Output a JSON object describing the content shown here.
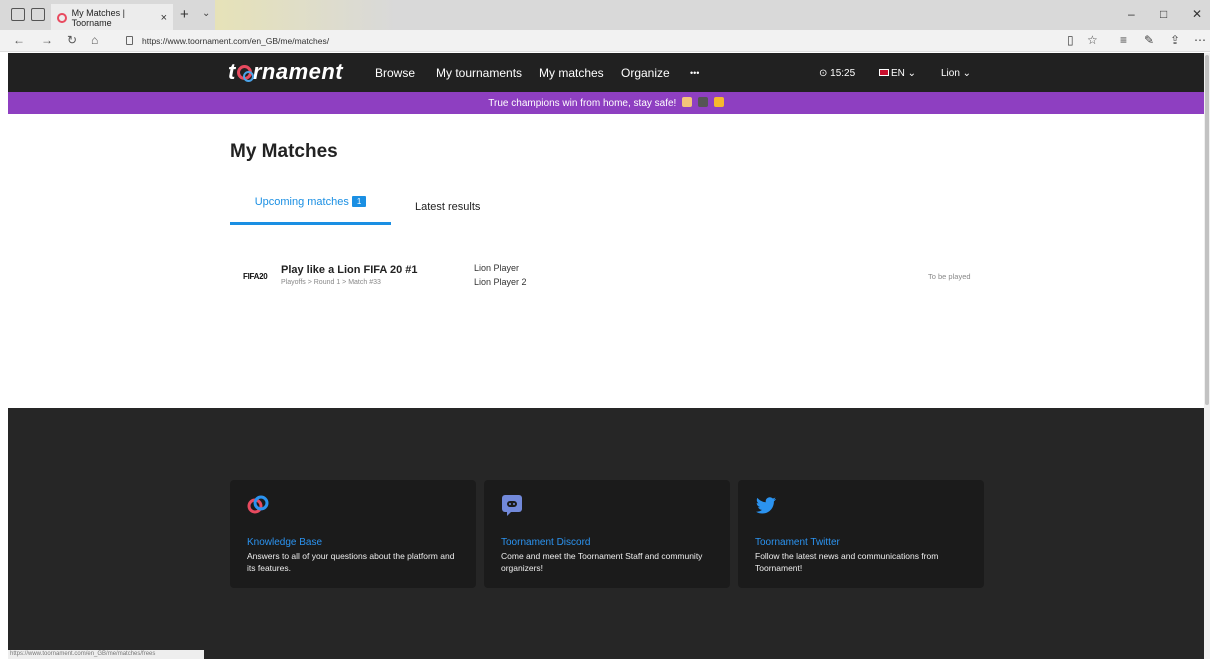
{
  "browser": {
    "tab_title": "My Matches | Toorname",
    "url": "https://www.toornament.com/en_GB/me/matches/",
    "new_tab": "+",
    "tab_close": "×",
    "window_controls": [
      "–",
      "□",
      "✕"
    ]
  },
  "header": {
    "logo": "toornament",
    "nav": [
      "Browse",
      "My tournaments",
      "My matches",
      "Organize",
      "•••"
    ],
    "clock": "⊙ 15:25",
    "language": "EN ⌄",
    "user": "Lion ⌄"
  },
  "banner": {
    "text": "True champions win from home, stay safe!"
  },
  "main": {
    "title": "My Matches",
    "tabs": {
      "upcoming": {
        "label": "Upcoming matches",
        "count": "1"
      },
      "latest": {
        "label": "Latest results"
      }
    },
    "matches": [
      {
        "game": "FIFA20",
        "name": "Play like a Lion FIFA 20 #1",
        "path": "Playoffs > Round 1 > Match #33",
        "player1": "Lion Player",
        "player2": "Lion Player 2",
        "status": "To be played"
      }
    ]
  },
  "footer": {
    "cards": [
      {
        "title": "Knowledge Base",
        "desc": "Answers to all of your questions about the platform and its features.",
        "icon": "toornament-logo-icon"
      },
      {
        "title": "Toornament Discord",
        "desc": "Come and meet the Toornament Staff and community organizers!",
        "icon": "discord-icon"
      },
      {
        "title": "Toornament Twitter",
        "desc": "Follow the latest news and communications from Toornament!",
        "icon": "twitter-icon"
      }
    ]
  },
  "statusbar": {
    "text": "https://www.toornament.com/en_GB/me/matches/frees"
  },
  "colors": {
    "accent": "#1a8fe3",
    "banner": "#8e3fc1",
    "header": "#212121",
    "footer": "#262626",
    "brand_red": "#e84a5f"
  }
}
